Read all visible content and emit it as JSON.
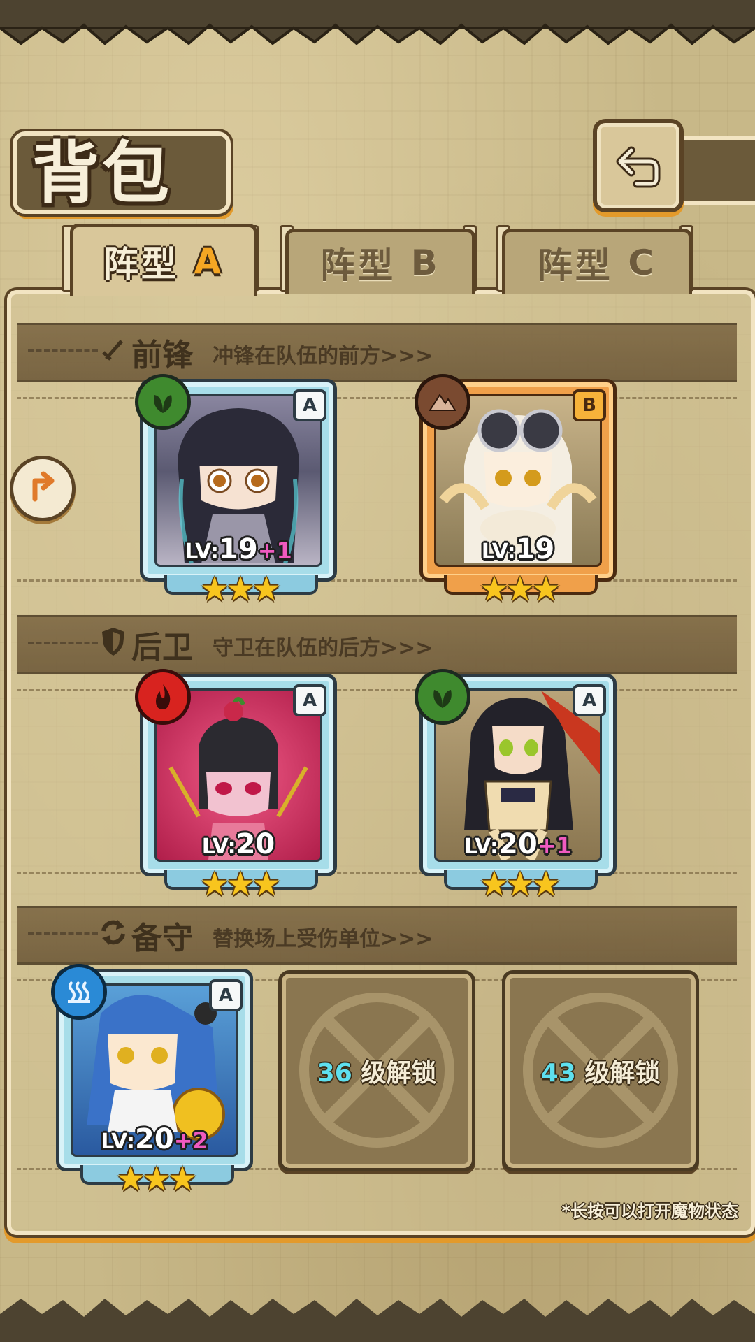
{
  "header": {
    "title": "背包"
  },
  "tabs": [
    {
      "prefix": "阵型",
      "letter": "A",
      "active": true
    },
    {
      "prefix": "阵型",
      "letter": "B",
      "active": false
    },
    {
      "prefix": "阵型",
      "letter": "C",
      "active": false
    }
  ],
  "sections": {
    "front": {
      "title": "前锋",
      "subtitle": "冲锋在队伍的前方>>>",
      "icon": "sword-icon"
    },
    "back": {
      "title": "后卫",
      "subtitle": "守卫在队伍的后方>>>",
      "icon": "shield-icon"
    },
    "reserve": {
      "title": "备守",
      "subtitle": "替换场上受伤单位>>>",
      "icon": "swap-icon"
    }
  },
  "units": {
    "front1": {
      "rank": "A",
      "element": "leaf-icon",
      "lv_label": "LV:",
      "level": "19",
      "bonus": "+1",
      "stars": 3,
      "frame": "blue"
    },
    "front2": {
      "rank": "B",
      "element": "mountain-icon",
      "lv_label": "LV:",
      "level": "19",
      "bonus": "",
      "stars": 3,
      "frame": "orange"
    },
    "back1": {
      "rank": "A",
      "element": "fire-icon",
      "lv_label": "LV:",
      "level": "20",
      "bonus": "",
      "stars": 3,
      "frame": "blue"
    },
    "back2": {
      "rank": "A",
      "element": "leaf-icon",
      "lv_label": "LV:",
      "level": "20",
      "bonus": "+1",
      "stars": 3,
      "frame": "blue"
    },
    "reserve1": {
      "rank": "A",
      "element": "water-icon",
      "lv_label": "LV:",
      "level": "20",
      "bonus": "+2",
      "stars": 3,
      "frame": "blue"
    }
  },
  "locked_slots": [
    {
      "level": "36",
      "label": "级解锁"
    },
    {
      "level": "43",
      "label": "级解锁"
    }
  ],
  "footer": {
    "hint": "*长按可以打开魔物状态"
  },
  "colors": {
    "accent_orange": "#e39a2b",
    "frame_dark": "#5a4325",
    "leaf_green": "#3f8a2e",
    "fire_red": "#d8231f",
    "water_blue": "#2a8ad6",
    "earth_brown": "#7a4a30",
    "lock_cyan": "#5ee0ef",
    "bonus_pink": "#f05ac0"
  }
}
